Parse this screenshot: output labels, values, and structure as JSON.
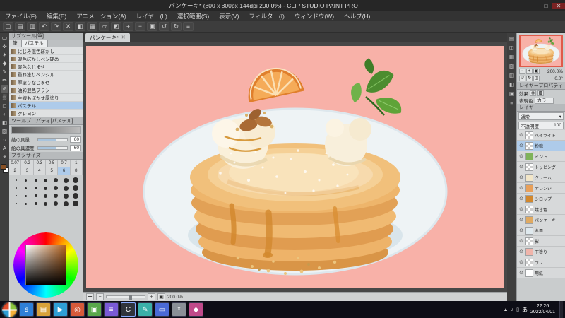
{
  "theme": {
    "titlebar_bg": "#262626",
    "menubar_bg": "#333333",
    "toolbar_bg": "#3d3d3d",
    "panel_bg": "#c9cccd",
    "panel_header_bg": "#b7babc",
    "panel_border": "#96999c",
    "viewport_bg": "#474747",
    "canvas_bg": "#f8b1a8",
    "accent": "#aecbea",
    "selection_red": "#e05a4a",
    "taskbar_bg": "#0d0d16",
    "text_dark": "#242424"
  },
  "window": {
    "title": "パンケーキ* (800 x 800px 144dpi 200.0%) - CLIP STUDIO PAINT PRO",
    "minimize": "─",
    "maximize": "□",
    "close": "✕"
  },
  "menubar": {
    "items": [
      "ファイル(F)",
      "編集(E)",
      "アニメーション(A)",
      "レイヤー(L)",
      "選択範囲(S)",
      "表示(V)",
      "フィルター(I)",
      "ウィンドウ(W)",
      "ヘルプ(H)"
    ]
  },
  "toolbar": {
    "buttons": [
      {
        "name": "new",
        "glyph": "▢"
      },
      {
        "name": "open",
        "glyph": "▤"
      },
      {
        "name": "save",
        "glyph": "▥"
      },
      {
        "name": "undo",
        "glyph": "↶"
      },
      {
        "name": "redo",
        "glyph": "↷"
      },
      {
        "name": "delete",
        "glyph": "✕"
      },
      {
        "name": "fill",
        "glyph": "◧"
      },
      {
        "name": "grid",
        "glyph": "▦"
      },
      {
        "name": "deselect",
        "glyph": "▱"
      },
      {
        "name": "invert-selection",
        "glyph": "◩"
      },
      {
        "name": "zoom-in",
        "glyph": "+"
      },
      {
        "name": "zoom-out",
        "glyph": "−"
      },
      {
        "name": "fit-screen",
        "glyph": "▣"
      },
      {
        "name": "rotate-left",
        "glyph": "↺"
      },
      {
        "name": "rotate-right",
        "glyph": "↻"
      },
      {
        "name": "settings",
        "glyph": "≡"
      }
    ]
  },
  "toolstrip": {
    "tools": [
      {
        "name": "selection",
        "glyph": "▭"
      },
      {
        "name": "move",
        "glyph": "✛"
      },
      {
        "name": "magic-wand",
        "glyph": "✶"
      },
      {
        "name": "eyedropper",
        "glyph": "◆"
      },
      {
        "name": "pen",
        "glyph": "✎"
      },
      {
        "name": "pencil",
        "glyph": "✏"
      },
      {
        "name": "brush",
        "glyph": "✐"
      },
      {
        "name": "airbrush",
        "glyph": "▒"
      },
      {
        "name": "eraser",
        "glyph": "◻"
      },
      {
        "name": "blend",
        "glyph": "◐"
      },
      {
        "name": "fill-bucket",
        "glyph": "◧"
      },
      {
        "name": "gradient",
        "glyph": "▨"
      },
      {
        "name": "figure",
        "glyph": "○"
      },
      {
        "name": "text",
        "glyph": "A"
      },
      {
        "name": "zoom",
        "glyph": "⌖"
      }
    ],
    "fg_color": "#8a5226",
    "bg_color": "#ffffff"
  },
  "subtool": {
    "title": "サブツール[筆]",
    "tabs": [
      "筆",
      "パステル"
    ],
    "items": [
      {
        "label": "にじみ混色ぼかし"
      },
      {
        "label": "混色ぼかしペン硬め"
      },
      {
        "label": "混色なじませ"
      },
      {
        "label": "重ね塗りペンシル"
      },
      {
        "label": "厚塗りなじませ"
      },
      {
        "label": "油彩混色ブラシ"
      },
      {
        "label": "主線もぼかす厚塗り"
      },
      {
        "label": "パステル"
      },
      {
        "label": "クレヨン"
      }
    ]
  },
  "tool_property": {
    "title": "ツールプロパティ[パステル]",
    "sliders": [
      {
        "label": "絵の具量",
        "value": "60"
      },
      {
        "label": "絵の具濃度",
        "value": "60"
      }
    ]
  },
  "brush_size": {
    "title": "ブラシサイズ",
    "values": [
      "0.07",
      "0.2",
      "0.3",
      "0.5",
      "0.7",
      "1",
      "2",
      "3",
      "4",
      "5",
      "6",
      "8"
    ]
  },
  "color_wheel": {
    "current_color": "#8a5226"
  },
  "canvas": {
    "tab_label": "パンケーキ*",
    "tab_close": "✕",
    "zoom_text": "200.0%",
    "background": "#f8b1a8",
    "statusbar_icons": [
      {
        "name": "pan",
        "glyph": "✛"
      },
      {
        "name": "zoom-out",
        "glyph": "−"
      },
      {
        "name": "zoom-in",
        "glyph": "+"
      },
      {
        "name": "fit",
        "glyph": "▣"
      }
    ]
  },
  "navigator": {
    "zoom_out": "−",
    "zoom_in": "+",
    "fit": "▣",
    "zoom_value": "200.0%",
    "rotate_left": "↺",
    "rotate_right": "↻",
    "flip": "◫",
    "rotate_value": "0.0°"
  },
  "layer_property": {
    "title": "レイヤープロパティ",
    "effect_label": "効果",
    "expression_label": "表現色",
    "expression_value": "カラー"
  },
  "layers": {
    "title": "レイヤー",
    "blend_mode": "通常",
    "dropdown_caret": "▾",
    "opacity_label": "不透明度",
    "opacity_value": "100",
    "eye": "⊙",
    "items": [
      {
        "name": "ハイライト"
      },
      {
        "name": "粉糖"
      },
      {
        "name": "ミント",
        "tint": "#7fb35a"
      },
      {
        "name": "トッピング"
      },
      {
        "name": "クリーム",
        "tint": "#f2e6c8"
      },
      {
        "name": "オレンジ",
        "tint": "#e8a05a"
      },
      {
        "name": "シロップ",
        "tint": "#d2882e"
      },
      {
        "name": "焼き色"
      },
      {
        "name": "パンケーキ",
        "tint": "#e0aa62"
      },
      {
        "name": "お皿",
        "tint": "#dfe9ee"
      },
      {
        "name": "影"
      },
      {
        "name": "下塗り",
        "tint": "#f0b4aa"
      },
      {
        "name": "ラフ"
      },
      {
        "name": "用紙",
        "tint": "#ffffff"
      }
    ]
  },
  "taskbar": {
    "icons": [
      {
        "name": "internet-explorer",
        "glyph": "e",
        "color": "#2f7fd6"
      },
      {
        "name": "file-explorer",
        "glyph": "▤",
        "color": "#d8a23a"
      },
      {
        "name": "media-player",
        "glyph": "▶",
        "color": "#2f9fd6"
      },
      {
        "name": "browser",
        "glyph": "◎",
        "color": "#d65a3a"
      },
      {
        "name": "photo-viewer",
        "glyph": "▣",
        "color": "#59a84b"
      },
      {
        "name": "text-editor",
        "glyph": "≡",
        "color": "#7a5ad6"
      },
      {
        "name": "clip-studio-paint",
        "glyph": "C",
        "color": "#30343c"
      },
      {
        "name": "paint-tool",
        "glyph": "✎",
        "color": "#3ab0a8"
      },
      {
        "name": "mail-app",
        "glyph": "▭",
        "color": "#4a6ad6"
      },
      {
        "name": "settings-app",
        "glyph": "*",
        "color": "#8a8f96"
      },
      {
        "name": "game-app",
        "glyph": "◆",
        "color": "#c04a8a"
      }
    ],
    "tray_icons": [
      "▲",
      "♪",
      "▯"
    ],
    "ime": "あ",
    "time": "22:26",
    "date": "2022/04/01"
  }
}
